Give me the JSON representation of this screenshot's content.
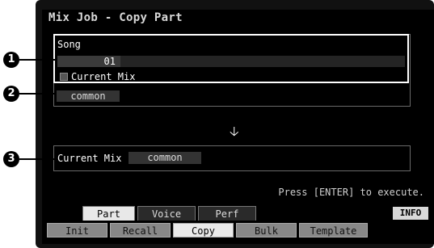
{
  "screen": {
    "title": "Mix Job - Copy Part",
    "source": {
      "song_label": "Song",
      "song_value": "01",
      "current_mix_label": "Current Mix",
      "part_value": "common"
    },
    "destination": {
      "current_mix_label": "Current Mix",
      "part_value": "common"
    },
    "hint": "Press [ENTER] to execute.",
    "upper_tabs": [
      "Part",
      "Voice",
      "Perf"
    ],
    "lower_tabs": [
      "Init",
      "Recall",
      "Copy",
      "Bulk",
      "Template"
    ],
    "info_label": "INFO"
  },
  "callouts": [
    "1",
    "2",
    "3"
  ]
}
